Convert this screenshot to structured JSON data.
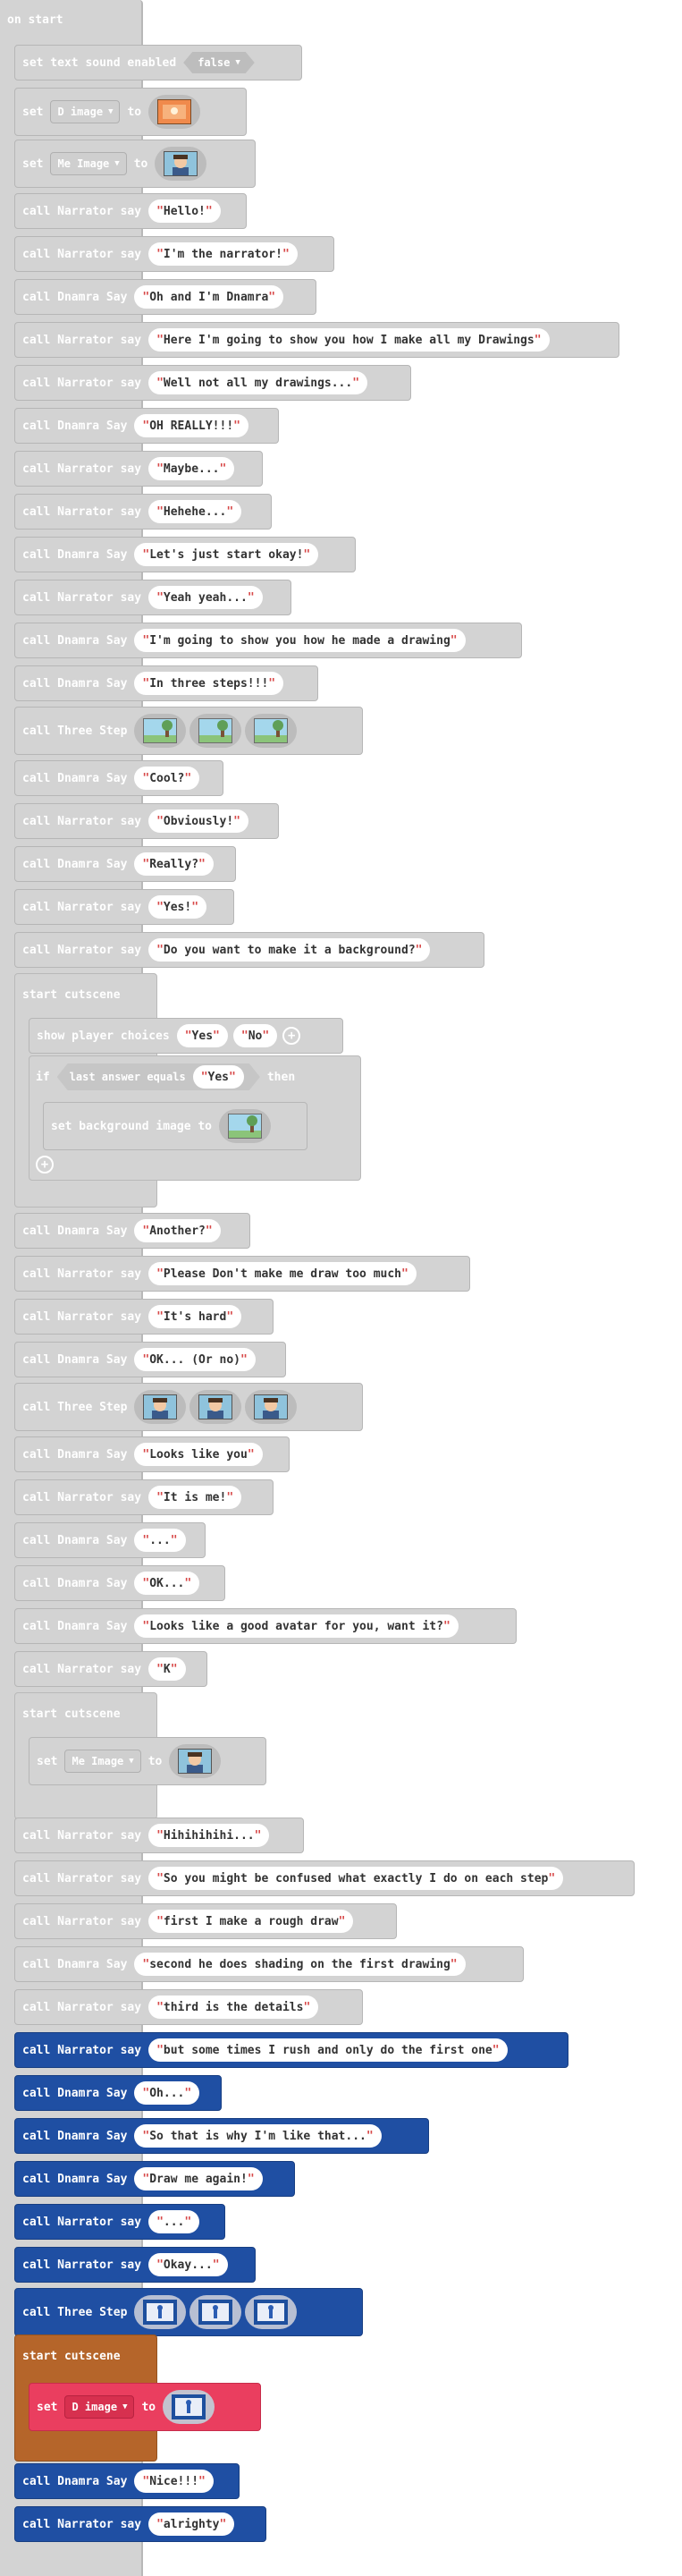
{
  "hat": {
    "label": "on start"
  },
  "text_sound": {
    "label": "set text sound enabled",
    "value": "false"
  },
  "set_d_image": {
    "set_label": "set",
    "variable": "D image",
    "to_label": "to",
    "image_icon": "orange-drawing-thumbnail"
  },
  "set_me_image": {
    "set_label": "set",
    "variable": "Me Image",
    "to_label": "to",
    "image_icon": "avatar-thumbnail"
  },
  "dialogue_1": [
    {
      "call": "call Narrator say",
      "text": "Hello!"
    },
    {
      "call": "call Narrator say",
      "text": "I'm the narrator!"
    },
    {
      "call": "call Dnamra Say",
      "text": "Oh and I'm Dnamra"
    },
    {
      "call": "call Narrator say",
      "text": "Here I'm going to show you how I make all my Drawings"
    },
    {
      "call": "call Narrator say",
      "text": "Well not all my drawings..."
    },
    {
      "call": "call Dnamra Say",
      "text": "OH REALLY!!!"
    },
    {
      "call": "call Narrator say",
      "text": "Maybe..."
    },
    {
      "call": "call Narrator say",
      "text": "Hehehe..."
    },
    {
      "call": "call Dnamra Say",
      "text": "Let's just start okay!"
    },
    {
      "call": "call Narrator say",
      "text": "Yeah yeah..."
    },
    {
      "call": "call Dnamra Say",
      "text": "I'm going to show you how he made a drawing"
    },
    {
      "call": "call Dnamra Say",
      "text": "In three steps!!!"
    }
  ],
  "three_step_1": {
    "call": "call Three Step",
    "images": [
      "tree-scene-sketch",
      "tree-scene-shaded",
      "tree-scene-detailed"
    ]
  },
  "dialogue_2": [
    {
      "call": "call Dnamra Say",
      "text": "Cool?"
    },
    {
      "call": "call Narrator say",
      "text": "Obviously!"
    },
    {
      "call": "call Dnamra Say",
      "text": "Really?"
    },
    {
      "call": "call Narrator say",
      "text": "Yes!"
    },
    {
      "call": "call Narrator say",
      "text": "Do you want to make it a background?"
    }
  ],
  "cutscene_1": {
    "title": "start cutscene",
    "choices_label": "show player choices",
    "choices": [
      "Yes",
      "No"
    ],
    "if_label": "if",
    "condition_label": "last answer equals",
    "condition_value": "Yes",
    "then_label": "then",
    "set_bg_label": "set background image to",
    "bg_image": "tree-scene-thumbnail"
  },
  "dialogue_3": [
    {
      "call": "call Dnamra Say",
      "text": "Another?"
    },
    {
      "call": "call Narrator say",
      "text": "Please Don't make me draw too much"
    },
    {
      "call": "call Narrator say",
      "text": "It's hard"
    },
    {
      "call": "call Dnamra Say",
      "text": "OK... (Or no)"
    }
  ],
  "three_step_2": {
    "call": "call Three Step",
    "images": [
      "avatar-sketch",
      "avatar-shaded",
      "avatar-detailed"
    ]
  },
  "dialogue_4": [
    {
      "call": "call Dnamra Say",
      "text": "Looks like you"
    },
    {
      "call": "call Narrator say",
      "text": "It is me!"
    },
    {
      "call": "call Dnamra Say",
      "text": "..."
    },
    {
      "call": "call Dnamra Say",
      "text": "OK..."
    },
    {
      "call": "call Dnamra Say",
      "text": "Looks like a good avatar for you, want it?"
    },
    {
      "call": "call Narrator say",
      "text": "K"
    }
  ],
  "cutscene_2": {
    "title": "start cutscene",
    "set_label": "set",
    "variable": "Me Image",
    "to_label": "to",
    "image_icon": "avatar-thumbnail"
  },
  "dialogue_5": [
    {
      "call": "call Narrator say",
      "text": "Hihihihihi..."
    },
    {
      "call": "call Narrator say",
      "text": "So you might be confused what exactly I do on each step"
    },
    {
      "call": "call Narrator say",
      "text": "first I make a rough draw"
    },
    {
      "call": "call Dnamra Say",
      "text": "second he does shading on the first drawing"
    },
    {
      "call": "call Narrator say",
      "text": "third is the details"
    }
  ],
  "dialogue_6": [
    {
      "call": "call Narrator say",
      "text": "but some times I rush and only do the first one"
    },
    {
      "call": "call Dnamra Say",
      "text": "Oh..."
    },
    {
      "call": "call Dnamra Say",
      "text": "So that is why I'm like that..."
    },
    {
      "call": "call Dnamra Say",
      "text": "Draw me again!"
    },
    {
      "call": "call Narrator say",
      "text": "..."
    },
    {
      "call": "call Narrator say",
      "text": "Okay..."
    }
  ],
  "three_step_3": {
    "call": "call Three Step",
    "images": [
      "blue-sketch-1",
      "blue-sketch-2",
      "blue-sketch-3"
    ]
  },
  "cutscene_3": {
    "title": "start cutscene",
    "set_label": "set",
    "variable": "D image",
    "to_label": "to",
    "image_icon": "blue-character-thumbnail"
  },
  "dialogue_7": [
    {
      "call": "call Dnamra Say",
      "text": "Nice!!!"
    },
    {
      "call": "call Narrator say",
      "text": "alrighty"
    }
  ],
  "colors": {
    "disabled_block": "#d3d3d3",
    "blue_block": "#1f4fa3",
    "cutscene_brown": "#b5652a",
    "variable_red": "#ea3e5f",
    "quote_red": "#d84a4a"
  }
}
